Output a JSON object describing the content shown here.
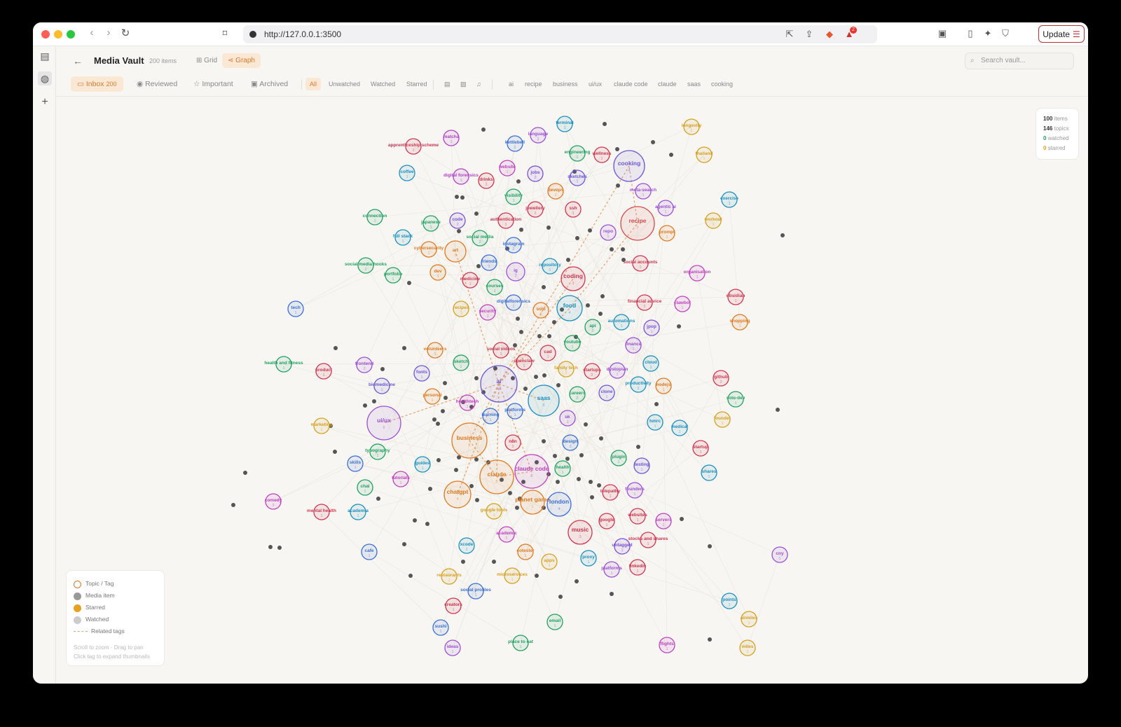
{
  "browser": {
    "url": "http://127.0.0.1:3500",
    "update_label": "Update",
    "badge_count": "2"
  },
  "header": {
    "title": "Media Vault",
    "count": "200 items",
    "views": [
      {
        "label": "Grid"
      },
      {
        "label": "Graph"
      }
    ],
    "search_placeholder": "Search vault..."
  },
  "status_tabs": [
    {
      "label": "Inbox",
      "badge": "200"
    },
    {
      "label": "Reviewed"
    },
    {
      "label": "Important"
    },
    {
      "label": "Archived"
    }
  ],
  "filter_tabs": [
    "All",
    "Unwatched",
    "Watched",
    "Starred"
  ],
  "tag_filters": [
    "ai",
    "recipe",
    "business",
    "ui/ux",
    "claude code",
    "claude",
    "saas",
    "cooking"
  ],
  "stats": {
    "items": "100",
    "items_label": "items",
    "topics": "146",
    "topics_label": "topics",
    "watched": "0",
    "watched_label": "watched",
    "starred": "0",
    "starred_label": "starred"
  },
  "legend": {
    "topic": "Topic / Tag",
    "media": "Media item",
    "starred": "Starred",
    "watched": "Watched",
    "related": "Related tags",
    "hint1": "Scroll to zoom · Drag to pan",
    "hint2": "Click tag to expand thumbnails"
  },
  "colors": {
    "accent": "#d97a2a",
    "media_dot": "#555555"
  },
  "graph": {
    "topics": [
      {
        "label": "apprenticeship scheme",
        "color": "#d1344f",
        "n": "1"
      },
      {
        "label": "matcha",
        "color": "#b040c8",
        "n": "1"
      },
      {
        "label": "kettlebell",
        "color": "#3a6fd8",
        "n": "1"
      },
      {
        "label": "language",
        "color": "#9b4fd8",
        "n": "1"
      },
      {
        "label": "terminal",
        "color": "#1a8fbf",
        "n": "1"
      },
      {
        "label": "longevity",
        "color": "#d6a020",
        "n": "1"
      },
      {
        "label": "engineering",
        "color": "#20a060",
        "n": "1"
      },
      {
        "label": "wellness",
        "color": "#d1344f",
        "n": "1"
      },
      {
        "label": "cooking",
        "color": "#6a58d8",
        "n": "4"
      },
      {
        "label": "thailand",
        "color": "#d6a020",
        "n": "1"
      },
      {
        "label": "coffee",
        "color": "#1a8fbf",
        "n": "1"
      },
      {
        "label": "digital forensics",
        "color": "#b040c8",
        "n": "1"
      },
      {
        "label": "website",
        "color": "#c040c0",
        "n": "1"
      },
      {
        "label": "jobs",
        "color": "#7a4fd8",
        "n": "2"
      },
      {
        "label": "sketches",
        "color": "#6a58d8",
        "n": "1"
      },
      {
        "label": "drinks",
        "color": "#d1344f",
        "n": "1"
      },
      {
        "label": "meta-search",
        "color": "#9b4fd8",
        "n": "1"
      },
      {
        "label": "visibility",
        "color": "#20a060",
        "n": "1"
      },
      {
        "label": "devops",
        "color": "#e07a20",
        "n": "1"
      },
      {
        "label": "exercise",
        "color": "#1a8fbf",
        "n": "1"
      },
      {
        "label": "jewellery",
        "color": "#d1344f",
        "n": "1"
      },
      {
        "label": "ssh",
        "color": "#d1344f",
        "n": "1"
      },
      {
        "label": "agentic ai",
        "color": "#9b4fd8",
        "n": "1"
      },
      {
        "label": "connection",
        "color": "#20a060",
        "n": "1"
      },
      {
        "label": "code",
        "color": "#7a4fd8",
        "n": "2"
      },
      {
        "label": "japanese",
        "color": "#20a060",
        "n": "1"
      },
      {
        "label": "authentication",
        "color": "#d1344f",
        "n": "1"
      },
      {
        "label": "recipe",
        "color": "#d94a4a",
        "n": "7"
      },
      {
        "label": "workout",
        "color": "#d6a020",
        "n": "2"
      },
      {
        "label": "full stack",
        "color": "#1a8fbf",
        "n": "1"
      },
      {
        "label": "social media",
        "color": "#20a060",
        "n": "2"
      },
      {
        "label": "repo",
        "color": "#9b4fd8",
        "n": "1"
      },
      {
        "label": "prompt",
        "color": "#e07a20",
        "n": "1"
      },
      {
        "label": "instagram",
        "color": "#3a6fd8",
        "n": "2"
      },
      {
        "label": "cybersecurity",
        "color": "#e07a20",
        "n": "1"
      },
      {
        "label": "art",
        "color": "#e07a20",
        "n": "3"
      },
      {
        "label": "social media hooks",
        "color": "#20a060",
        "n": "1"
      },
      {
        "label": "friends",
        "color": "#3a6fd8",
        "n": "1"
      },
      {
        "label": "repository",
        "color": "#1a8fbf",
        "n": "1"
      },
      {
        "label": "social accounts",
        "color": "#d1344f",
        "n": "1"
      },
      {
        "label": "organisation",
        "color": "#c040c0",
        "n": "1"
      },
      {
        "label": "portfolio",
        "color": "#20a060",
        "n": "1"
      },
      {
        "label": "dev",
        "color": "#e07a20",
        "n": "1"
      },
      {
        "label": "ig",
        "color": "#9b4fd8",
        "n": "2"
      },
      {
        "label": "coding",
        "color": "#d1344f",
        "n": "3"
      },
      {
        "label": "medicine",
        "color": "#d1344f",
        "n": "1"
      },
      {
        "label": "courses",
        "color": "#20a060",
        "n": "1"
      },
      {
        "label": "obsidian",
        "color": "#d1344f",
        "n": "1"
      },
      {
        "label": "digitalforensics",
        "color": "#3a6fd8",
        "n": "1"
      },
      {
        "label": "financial advice",
        "color": "#d1344f",
        "n": "1"
      },
      {
        "label": "clawbot",
        "color": "#c040c0",
        "n": "1"
      },
      {
        "label": "tech",
        "color": "#3a6fd8",
        "n": "1"
      },
      {
        "label": "recipes",
        "color": "#d6a020",
        "n": "1"
      },
      {
        "label": "security",
        "color": "#c040c0",
        "n": "1"
      },
      {
        "label": "solo",
        "color": "#e07a20",
        "n": "1"
      },
      {
        "label": "food",
        "color": "#1a8fbf",
        "n": "4"
      },
      {
        "label": "automations",
        "color": "#1a8fbf",
        "n": "1"
      },
      {
        "label": "api",
        "color": "#20a060",
        "n": "2"
      },
      {
        "label": "jpop",
        "color": "#7a4fd8",
        "n": "1"
      },
      {
        "label": "shopping",
        "color": "#e07a20",
        "n": "1"
      },
      {
        "label": "youtube",
        "color": "#20a060",
        "n": "1"
      },
      {
        "label": "finance",
        "color": "#9b4fd8",
        "n": "1"
      },
      {
        "label": "volunteers",
        "color": "#e07a20",
        "n": "1"
      },
      {
        "label": "social videos",
        "color": "#d1344f",
        "n": "1"
      },
      {
        "label": "cad",
        "color": "#d1344f",
        "n": "1"
      },
      {
        "label": "health and fitness",
        "color": "#20a060",
        "n": "1"
      },
      {
        "label": "frontend",
        "color": "#9b4fd8",
        "n": "2"
      },
      {
        "label": "sketch",
        "color": "#20a060",
        "n": "1"
      },
      {
        "label": "openclaw",
        "color": "#d1344f",
        "n": "1"
      },
      {
        "label": "family tech",
        "color": "#d6a020",
        "n": "1"
      },
      {
        "label": "startups",
        "color": "#d1344f",
        "n": "2"
      },
      {
        "label": "dystopian",
        "color": "#9b4fd8",
        "n": "1"
      },
      {
        "label": "cloud",
        "color": "#1a8fbf",
        "n": "1"
      },
      {
        "label": "github",
        "color": "#d1344f",
        "n": "2"
      },
      {
        "label": "product",
        "color": "#d1344f",
        "n": "1"
      },
      {
        "label": "fonts",
        "color": "#6a58d8",
        "n": "1"
      },
      {
        "label": "biomedicine",
        "color": "#6a58d8",
        "n": "1"
      },
      {
        "label": "ai",
        "color": "#6a58d8",
        "n": "12"
      },
      {
        "label": "nodejs",
        "color": "#e07a20",
        "n": "1"
      },
      {
        "label": "productivity",
        "color": "#1a8fbf",
        "n": "1"
      },
      {
        "label": "careers",
        "color": "#20a060",
        "n": "2"
      },
      {
        "label": "clone",
        "color": "#6a58d8",
        "n": "1"
      },
      {
        "label": "saas",
        "color": "#1a8fbf",
        "n": "6"
      },
      {
        "label": "solo-dev",
        "color": "#20a060",
        "n": "1"
      },
      {
        "label": "personal",
        "color": "#e07a20",
        "n": "1"
      },
      {
        "label": "healthtech",
        "color": "#c040c0",
        "n": "1"
      },
      {
        "label": "platforms",
        "color": "#3a6fd8",
        "n": "1"
      },
      {
        "label": "founder",
        "color": "#d6a020",
        "n": "1"
      },
      {
        "label": "ui/ux",
        "color": "#9b4fd8",
        "n": "6"
      },
      {
        "label": "marketing",
        "color": "#d6a020",
        "n": "1"
      },
      {
        "label": "learning",
        "color": "#3a6fd8",
        "n": "1"
      },
      {
        "label": "uk",
        "color": "#9b4fd8",
        "n": "1"
      },
      {
        "label": "hmrc",
        "color": "#1a8fbf",
        "n": "1"
      },
      {
        "label": "medical",
        "color": "#1a8fbf",
        "n": "1"
      },
      {
        "label": "business",
        "color": "#e07a20",
        "n": "8"
      },
      {
        "label": "n8n",
        "color": "#d1344f",
        "n": "2"
      },
      {
        "label": "design",
        "color": "#3a6fd8",
        "n": "2"
      },
      {
        "label": "startup",
        "color": "#d1344f",
        "n": "1"
      },
      {
        "label": "typography",
        "color": "#20a060",
        "n": "1"
      },
      {
        "label": "plugin",
        "color": "#20a060",
        "n": "1"
      },
      {
        "label": "testing",
        "color": "#6a58d8",
        "n": "1"
      },
      {
        "label": "skills",
        "color": "#3a6fd8",
        "n": "1"
      },
      {
        "label": "guides",
        "color": "#1a8fbf",
        "n": "1"
      },
      {
        "label": "claude",
        "color": "#e07a20",
        "n": "8"
      },
      {
        "label": "claude code",
        "color": "#c040c0",
        "n": "8"
      },
      {
        "label": "health",
        "color": "#20a060",
        "n": "1"
      },
      {
        "label": "shares",
        "color": "#1a8fbf",
        "n": "1"
      },
      {
        "label": "chai",
        "color": "#20a060",
        "n": "1"
      },
      {
        "label": "tutorials",
        "color": "#c040c0",
        "n": "1"
      },
      {
        "label": "founders",
        "color": "#9b4fd8",
        "n": "1"
      },
      {
        "label": "telepathy",
        "color": "#d1344f",
        "n": "1"
      },
      {
        "label": "comedy",
        "color": "#c040c0",
        "n": "3"
      },
      {
        "label": "chatgpt",
        "color": "#e07a20",
        "n": "4"
      },
      {
        "label": "planet game",
        "color": "#e07a20",
        "n": "1"
      },
      {
        "label": "london",
        "color": "#3a6fd8",
        "n": "4"
      },
      {
        "label": "google tools",
        "color": "#d6a020",
        "n": "1"
      },
      {
        "label": "mental health",
        "color": "#d1344f",
        "n": "1"
      },
      {
        "label": "academia",
        "color": "#1a8fbf",
        "n": "1"
      },
      {
        "label": "websites",
        "color": "#d1344f",
        "n": "1"
      },
      {
        "label": "servers",
        "color": "#c040c0",
        "n": "1"
      },
      {
        "label": "google",
        "color": "#d1344f",
        "n": "1"
      },
      {
        "label": "academic",
        "color": "#c040c0",
        "n": "1"
      },
      {
        "label": "music",
        "color": "#d1344f",
        "n": "3"
      },
      {
        "label": "stocks and shares",
        "color": "#d1344f",
        "n": "1"
      },
      {
        "label": "untagged",
        "color": "#7a4fd8",
        "n": "1"
      },
      {
        "label": "cafe",
        "color": "#3a6fd8",
        "n": "1"
      },
      {
        "label": "xcode",
        "color": "#1a8fbf",
        "n": "1"
      },
      {
        "label": "cotester",
        "color": "#e07a20",
        "n": "1"
      },
      {
        "label": "proxy",
        "color": "#1a8fbf",
        "n": "1"
      },
      {
        "label": "cny",
        "color": "#9b4fd8",
        "n": "1"
      },
      {
        "label": "apps",
        "color": "#d6a020",
        "n": "1"
      },
      {
        "label": "platforms",
        "color": "#9b4fd8",
        "n": "1"
      },
      {
        "label": "linkedin",
        "color": "#d1344f",
        "n": "1"
      },
      {
        "label": "restaurants",
        "color": "#d6a020",
        "n": "1"
      },
      {
        "label": "microservices",
        "color": "#d6a020",
        "n": "1"
      },
      {
        "label": "social profiles",
        "color": "#3a6fd8",
        "n": "1"
      },
      {
        "label": "creators",
        "color": "#d1344f",
        "n": "1"
      },
      {
        "label": "email",
        "color": "#20a060",
        "n": "1"
      },
      {
        "label": "points",
        "color": "#1a8fbf",
        "n": "1"
      },
      {
        "label": "airmiles",
        "color": "#d6a020",
        "n": "1"
      },
      {
        "label": "sushi",
        "color": "#3a6fd8",
        "n": "1"
      },
      {
        "label": "place to eat",
        "color": "#20a060",
        "n": "1"
      },
      {
        "label": "flights",
        "color": "#c040c0",
        "n": "1"
      },
      {
        "label": "ideas",
        "color": "#9b4fd8",
        "n": "1"
      },
      {
        "label": "miles",
        "color": "#d6a020",
        "n": "1"
      }
    ]
  }
}
